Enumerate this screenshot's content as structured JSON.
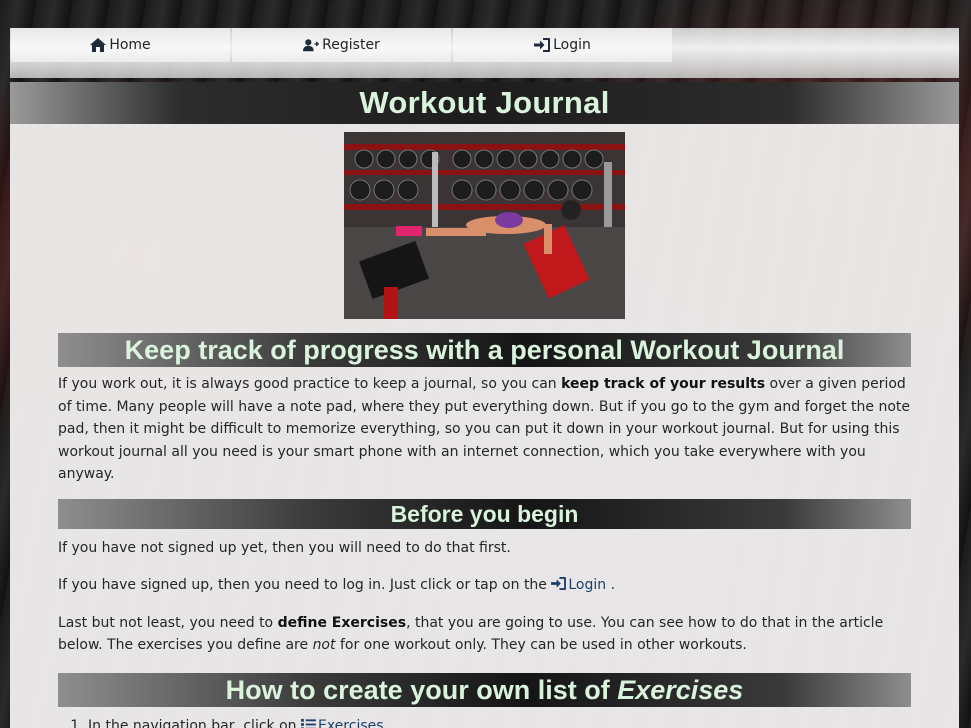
{
  "nav": {
    "home": "Home",
    "register": "Register",
    "login": "Login"
  },
  "page": {
    "title": "Workout Journal"
  },
  "section1": {
    "heading": "Keep track of progress with a personal Workout Journal",
    "text_a": "If you work out, it is always good practice to keep a journal, so you can ",
    "bold": "keep track of your results",
    "text_b": " over a given period of time. Many people will have a note pad, where they put everything down. But if you go to the gym and forget the note pad, then it might be difficult to memorize everything, so you can put it down in your workout journal. But for using this workout journal all you need is your smart phone with an internet connection, which you take everywhere with you anyway."
  },
  "section2": {
    "heading": "Before you begin",
    "p1": "If you have not signed up yet, then you will need to do that first.",
    "p2_before": "If you have signed up, then you need to log in. Just click or tap on the ",
    "p2_link": "Login",
    "p2_after": " .",
    "p3_before": "Last but not least, you need to ",
    "p3_bold": "define Exercises",
    "p3_mid": ", that you are going to use. You can see how to do that in the article below. The exercises you define are ",
    "p3_italic": "not",
    "p3_after": " for one workout only. They can be used in other workouts."
  },
  "section3": {
    "heading_plain": "How to create your own list of ",
    "heading_italic": "Exercises",
    "step1_before": "In the navigation bar, click on ",
    "step1_link": "Exercises"
  },
  "colors": {
    "heading_text": "#d9f3dc",
    "link": "#1a3f6b",
    "panel_bg": "#f6f4f4"
  },
  "icons": {
    "home": "home-icon",
    "register": "user-plus-icon",
    "login": "sign-in-icon",
    "exercises": "list-icon"
  }
}
